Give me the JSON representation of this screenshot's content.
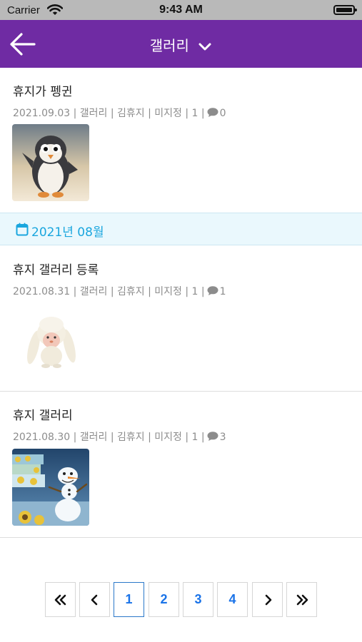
{
  "status_bar": {
    "carrier": "Carrier",
    "time": "9:43 AM"
  },
  "header": {
    "title": "갤러리",
    "back_icon": "arrow-left-icon",
    "dropdown_icon": "chevron-down-icon",
    "color": "#6f2ba3"
  },
  "posts": [
    {
      "title": "휴지가 펭귄",
      "meta": "2021.09.03 | 갤러리 | 김휴지 | 미지정 |   1 |",
      "comments": "0",
      "thumbnail": "penguin plush photo"
    },
    {
      "title": "휴지 갤러리 등록",
      "meta": "2021.08.31 | 갤러리 | 김휴지 | 미지정 |   1 |",
      "comments": "1",
      "thumbnail": "white bunny plush photo"
    },
    {
      "title": "휴지 갤러리",
      "meta": "2021.08.30 | 갤러리 | 김휴지 | 미지정 |   1 |",
      "comments": "3",
      "thumbnail": "snowman figure photo"
    }
  ],
  "month_divider": {
    "label": "2021년 08월",
    "icon": "calendar-icon",
    "color": "#1aa6de"
  },
  "pagination": {
    "first_icon": "double-chevron-left-icon",
    "prev_icon": "chevron-left-icon",
    "pages": [
      "1",
      "2",
      "3",
      "4"
    ],
    "current": "1",
    "next_icon": "chevron-right-icon",
    "last_icon": "double-chevron-right-icon"
  }
}
